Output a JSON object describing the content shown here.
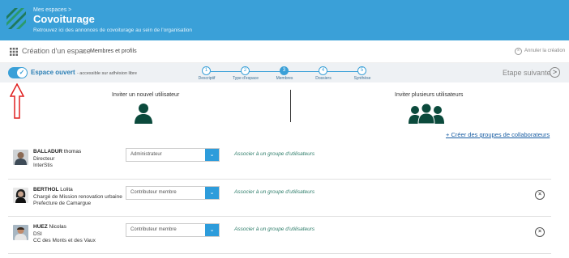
{
  "header": {
    "breadcrumb": "Mes espaces >",
    "title": "Covoiturage",
    "subtitle": "Retrouvez ici des annonces de covoiturage au sein de l'organisation",
    "color": "#3aa0d8"
  },
  "titlebar": {
    "main": "Création d'un espace",
    "separator": ">",
    "sub": "Membres et profils",
    "cancel_label": "Annuler la création",
    "cancel_icon": "×"
  },
  "stepbar": {
    "space_label": "Espace ouvert",
    "space_sub": "- accessible sur adhésion libre",
    "toggle_on": true,
    "steps": [
      {
        "num": "1",
        "label": "Descriptif"
      },
      {
        "num": "2",
        "label": "Type d'espace"
      },
      {
        "num": "3",
        "label": "Membres"
      },
      {
        "num": "4",
        "label": "Dossiers"
      },
      {
        "num": "5",
        "label": "Synthèse"
      }
    ],
    "active_step": 3,
    "next_label": "Etape suivante",
    "next_icon": ">"
  },
  "invite": {
    "single_label": "Inviter un nouvel utilisateur",
    "multi_label": "Inviter plusieurs utilisateurs",
    "create_groups": "+ Créer des groupes de collaborateurs",
    "icon_color": "#0b4a3c"
  },
  "members": [
    {
      "last": "BALLADUR",
      "first": "thomas",
      "role": "Directeur",
      "org": "InterStis",
      "profile": "Administrateur",
      "assoc": "Associer à un groupe d'utilisateurs",
      "removable": false
    },
    {
      "last": "BERTHOL",
      "first": "Lolita",
      "role": "Chargé de Mission renovation urbaine",
      "org": "Prefecture de Camargue",
      "profile": "Contributeur membre",
      "assoc": "Associer à un groupe d'utilisateurs",
      "removable": true
    },
    {
      "last": "HUEZ",
      "first": "Nicolas",
      "role": "DSI",
      "org": "CC des Monts et des Vaux",
      "profile": "Contributeur membre",
      "assoc": "Associer à un groupe d'utilisateurs",
      "removable": true
    }
  ],
  "icons": {
    "remove": "×",
    "dropdown": "⌄",
    "check": "✓"
  }
}
